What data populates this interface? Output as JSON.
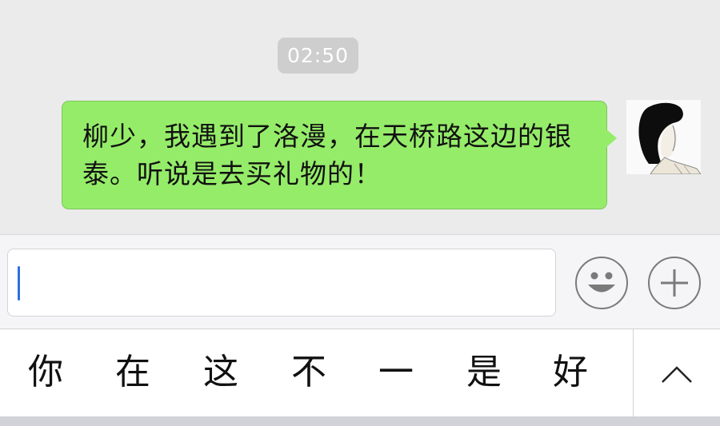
{
  "chat": {
    "timestamp": "02:50",
    "message": {
      "text": "柳少，我遇到了洛漫，在天桥路这边的银泰。听说是去买礼物的！",
      "bubble_color": "#95ec69",
      "sender": "self"
    },
    "avatar_icon": "user-avatar-icon"
  },
  "input_bar": {
    "value": "",
    "emoji_icon": "smiley-face-icon",
    "plus_icon": "plus-icon",
    "caret_color": "#2f6fe0"
  },
  "keyboard": {
    "candidates": [
      "你",
      "在",
      "这",
      "不",
      "一",
      "是",
      "好"
    ],
    "expand_icon": "chevron-up-icon"
  }
}
